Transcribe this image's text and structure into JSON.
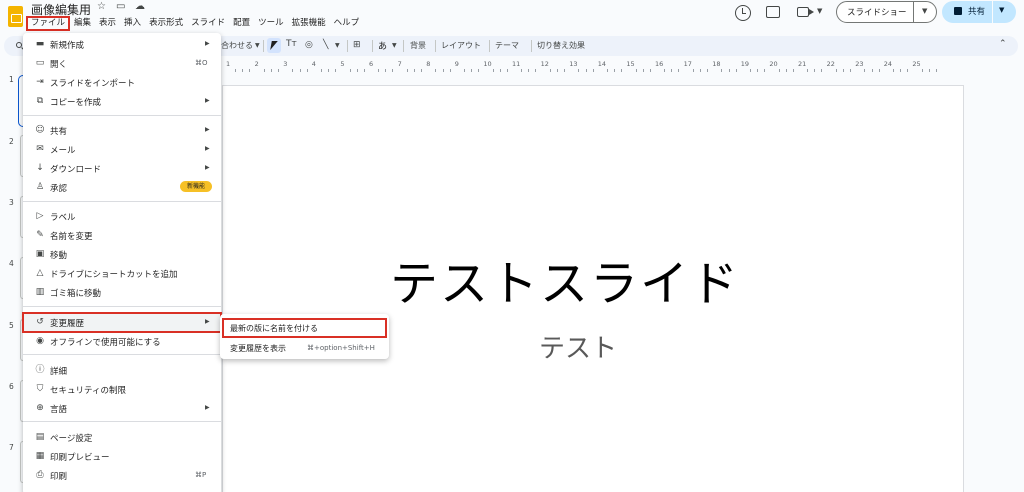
{
  "app": {
    "doc_title": "画像編集用"
  },
  "menubar": [
    "ファイル",
    "編集",
    "表示",
    "挿入",
    "表示形式",
    "スライド",
    "配置",
    "ツール",
    "拡張機能",
    "ヘルプ"
  ],
  "header": {
    "slideshow_label": "スライドショー",
    "share_label": "共有"
  },
  "toolbar": {
    "fit_label": "合わせる",
    "text_icon": "Tт",
    "input_tools": "あ",
    "background": "背景",
    "layout": "レイアウト",
    "theme": "テーマ",
    "transition": "切り替え効果"
  },
  "ruler": [
    "1",
    "2",
    "3",
    "4",
    "5",
    "6",
    "7",
    "8",
    "9",
    "10",
    "11",
    "12",
    "13",
    "14",
    "15",
    "16",
    "17",
    "18",
    "19",
    "20",
    "21",
    "22",
    "23",
    "24",
    "25"
  ],
  "slides": [
    "1",
    "2",
    "3",
    "4",
    "5",
    "6",
    "7"
  ],
  "slide": {
    "title": "テストスライド",
    "subtitle": "テスト"
  },
  "file_menu": {
    "new": "新規作成",
    "open": "開く",
    "open_shortcut": "⌘O",
    "import": "スライドをインポート",
    "copy": "コピーを作成",
    "share": "共有",
    "email": "メール",
    "download": "ダウンロード",
    "approval": "承認",
    "approval_badge": "新機能",
    "label": "ラベル",
    "rename": "名前を変更",
    "move": "移動",
    "shortcut": "ドライブにショートカットを追加",
    "trash": "ゴミ箱に移動",
    "version_history": "変更履歴",
    "offline": "オフラインで使用可能にする",
    "details": "詳細",
    "security": "セキュリティの制限",
    "language": "言語",
    "page_setup": "ページ設定",
    "print_preview": "印刷プレビュー",
    "print": "印刷",
    "print_shortcut": "⌘P"
  },
  "submenu": {
    "name_version": "最新の版に名前を付ける",
    "show_history": "変更履歴を表示",
    "show_history_shortcut": "⌘+option+Shift+H"
  },
  "colors": {
    "highlight": "#d93025",
    "accent": "#0b57d0",
    "share_bg": "#c2e7ff",
    "badge": "#f6c026"
  }
}
